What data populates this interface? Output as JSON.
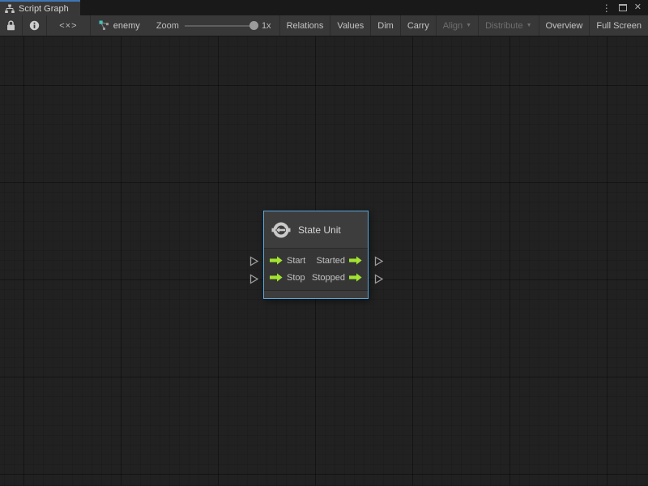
{
  "tab_bar": {
    "active_tab": {
      "label": "Script Graph"
    },
    "window_controls": {
      "menu_icon": "⋮",
      "close_icon": "✕"
    }
  },
  "toolbar": {
    "code_toggle_label": "<×>",
    "graph_name": "enemy",
    "zoom": {
      "label": "Zoom",
      "value": "1x"
    },
    "buttons": [
      {
        "label": "Relations",
        "enabled": true
      },
      {
        "label": "Values",
        "enabled": true
      },
      {
        "label": "Dim",
        "enabled": true
      },
      {
        "label": "Carry",
        "enabled": true
      },
      {
        "label": "Align",
        "enabled": false,
        "dropdown": "▼"
      },
      {
        "label": "Distribute",
        "enabled": false,
        "dropdown": "▼"
      },
      {
        "label": "Overview",
        "enabled": true
      },
      {
        "label": "Full Screen",
        "enabled": true
      }
    ]
  },
  "node": {
    "title": "State Unit",
    "ports": [
      {
        "input": "Start",
        "output": "Started"
      },
      {
        "input": "Stop",
        "output": "Stopped"
      }
    ]
  },
  "colors": {
    "accent_blue": "#3c78b8",
    "selection_blue": "#56a7dc",
    "port_green": "#a2e42f",
    "canvas_bg": "#212121",
    "panel_bg": "#383838"
  }
}
